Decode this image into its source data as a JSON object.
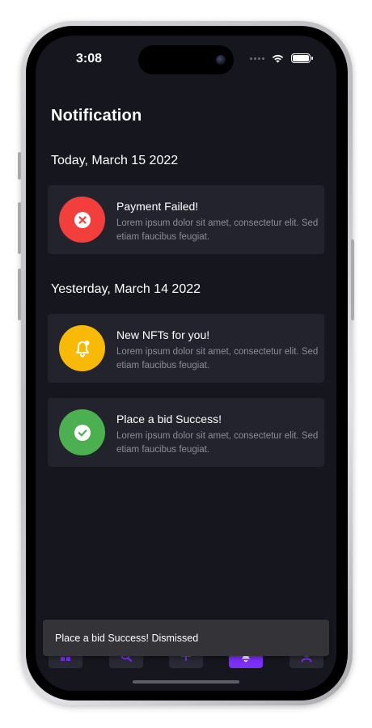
{
  "status_bar": {
    "time": "3:08"
  },
  "page": {
    "title": "Notification"
  },
  "sections": [
    {
      "title": "Today, March 15 2022"
    },
    {
      "title": "Yesterday, March 14 2022"
    }
  ],
  "notifications": [
    {
      "title": "Payment Failed!",
      "description": "Lorem ipsum dolor sit amet, consectetur elit. Sed etiam faucibus feugiat.",
      "icon": "error-x-icon",
      "color": "#f23f3b"
    },
    {
      "title": "New NFTs for you!",
      "description": "Lorem ipsum dolor sit amet, consectetur elit. Sed etiam faucibus feugiat.",
      "icon": "bell-icon",
      "color": "#f9b907"
    },
    {
      "title": "Place a bid Success!",
      "description": "Lorem ipsum dolor sit amet, consectetur elit. Sed etiam faucibus feugiat.",
      "icon": "check-icon",
      "color": "#4caf50"
    }
  ],
  "tabbar": {
    "icons": [
      "home-icon",
      "search-icon",
      "add-icon",
      "notification-icon",
      "profile-icon"
    ],
    "active_index": 3,
    "active_color": "#7b2ff7"
  },
  "snackbar": {
    "message": "Place a bid Success! Dismissed"
  }
}
